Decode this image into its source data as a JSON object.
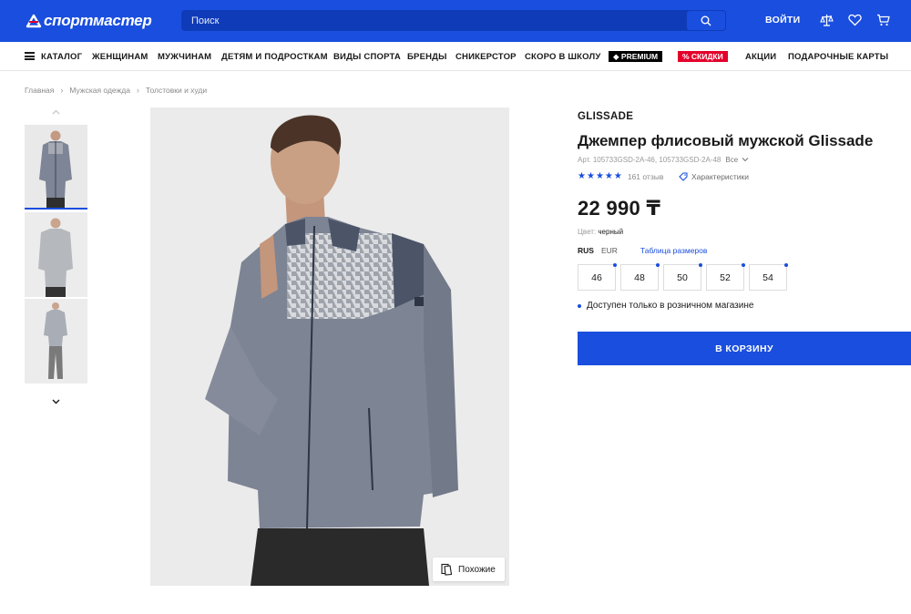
{
  "header": {
    "logo_text": "спортмастер",
    "search_placeholder": "Поиск",
    "login_label": "ВОЙТИ",
    "icons": [
      "search-icon",
      "compare-icon",
      "heart-icon",
      "cart-icon"
    ]
  },
  "nav": {
    "items": [
      {
        "label": "КАТАЛОГ"
      },
      {
        "label": "ЖЕНЩИНАМ"
      },
      {
        "label": "МУЖЧИНАМ"
      },
      {
        "label": "ДЕТЯМ И ПОДРОСТКАМ"
      },
      {
        "label": "ВИДЫ СПОРТА"
      },
      {
        "label": "БРЕНДЫ"
      },
      {
        "label": "СНИКЕРСТОР"
      },
      {
        "label": "СКОРО В ШКОЛУ"
      },
      {
        "label": "PREMIUM"
      },
      {
        "label": "% СКИДКИ"
      },
      {
        "label": "АКЦИИ"
      },
      {
        "label": "ПОДАРОЧНЫЕ КАРТЫ"
      }
    ]
  },
  "breadcrumb": [
    "Главная",
    "Мужская одежда",
    "Толстовки и худи"
  ],
  "gallery": {
    "similar_label": "Похожие"
  },
  "product": {
    "brand": "GLISSADE",
    "title": "Джемпер флисовый мужской Glissade",
    "article": "Арт. 105733GSD-2A-46, 105733GSD-2A-48",
    "article_all": "Все",
    "rating": 5,
    "reviews": "161 отзыв",
    "characteristics_label": "Характеристики",
    "price": "22 990 ₸",
    "color_label": "Цвет:",
    "color_value": "черный",
    "size_systems": {
      "active": "RUS",
      "other": "EUR"
    },
    "size_table_label": "Таблица размеров",
    "sizes": [
      "46",
      "48",
      "50",
      "52",
      "54"
    ],
    "availability": "Доступен только в розничном магазине",
    "cart_button": "В КОРЗИНУ"
  },
  "colors": {
    "brand_blue": "#1a4ede",
    "sale_red": "#e4002b",
    "premium_black": "#000000"
  }
}
